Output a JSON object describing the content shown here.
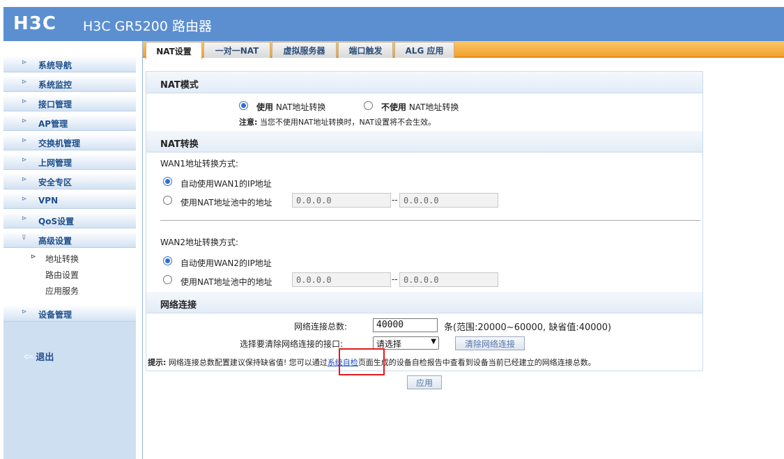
{
  "header": {
    "logo": "H3C",
    "title": "H3C GR5200 路由器"
  },
  "sidebar": {
    "items": [
      {
        "label": "系统导航"
      },
      {
        "label": "系统监控"
      },
      {
        "label": "接口管理"
      },
      {
        "label": "AP管理"
      },
      {
        "label": "交换机管理"
      },
      {
        "label": "上网管理"
      },
      {
        "label": "安全专区"
      },
      {
        "label": "VPN"
      },
      {
        "label": "QoS设置"
      },
      {
        "label": "高级设置"
      },
      {
        "label": "设备管理"
      }
    ],
    "sub_items": [
      {
        "label": "地址转换"
      },
      {
        "label": "路由设置"
      },
      {
        "label": "应用服务"
      }
    ],
    "logout_label": "退出"
  },
  "tabs": [
    {
      "label": "NAT设置"
    },
    {
      "label": "一对一NAT"
    },
    {
      "label": "虚拟服务器"
    },
    {
      "label": "端口触发"
    },
    {
      "label": "ALG 应用"
    }
  ],
  "nat_mode": {
    "heading": "NAT模式",
    "use_bold": "使用",
    "use_rest": " NAT地址转换",
    "nouse_bold": "不使用",
    "nouse_rest": " NAT地址转换",
    "note_bold": "注意:",
    "note_rest": " 当您不使用NAT地址转换时，NAT设置将不会生效。"
  },
  "nat_convert": {
    "heading": "NAT转换",
    "wan1_label": "WAN1地址转换方式:",
    "wan1_auto": "自动使用WAN1的IP地址",
    "wan1_pool": "使用NAT地址池中的地址",
    "wan1_start": "0.0.0.0",
    "wan1_end": "0.0.0.0",
    "wan2_label": "WAN2地址转换方式:",
    "wan2_auto": "自动使用WAN2的IP地址",
    "wan2_pool": "使用NAT地址池中的地址",
    "wan2_start": "0.0.0.0",
    "wan2_end": "0.0.0.0",
    "range_sep": "--"
  },
  "network": {
    "heading": "网络连接",
    "total_label": "网络连接总数:",
    "total_value": "40000",
    "total_hint": "条(范围:20000~60000, 缺省值:40000)",
    "clear_label": "选择要清除网络连接的接口:",
    "clear_select": "请选择",
    "clear_button": "清除网络连接",
    "tip_bold": "提示:",
    "tip_before": " 网络连接总数配置建议保持缺省值! 您可以通过",
    "tip_link": "系统自检",
    "tip_after": "页面生成的设备自检报告中查看到设备当前已经建立的网络连接总数。"
  },
  "apply_button": "应用",
  "colors": {
    "header": "#5b8fd0",
    "tab_bar": "#f3a02d",
    "highlight": "#e01a1a"
  }
}
